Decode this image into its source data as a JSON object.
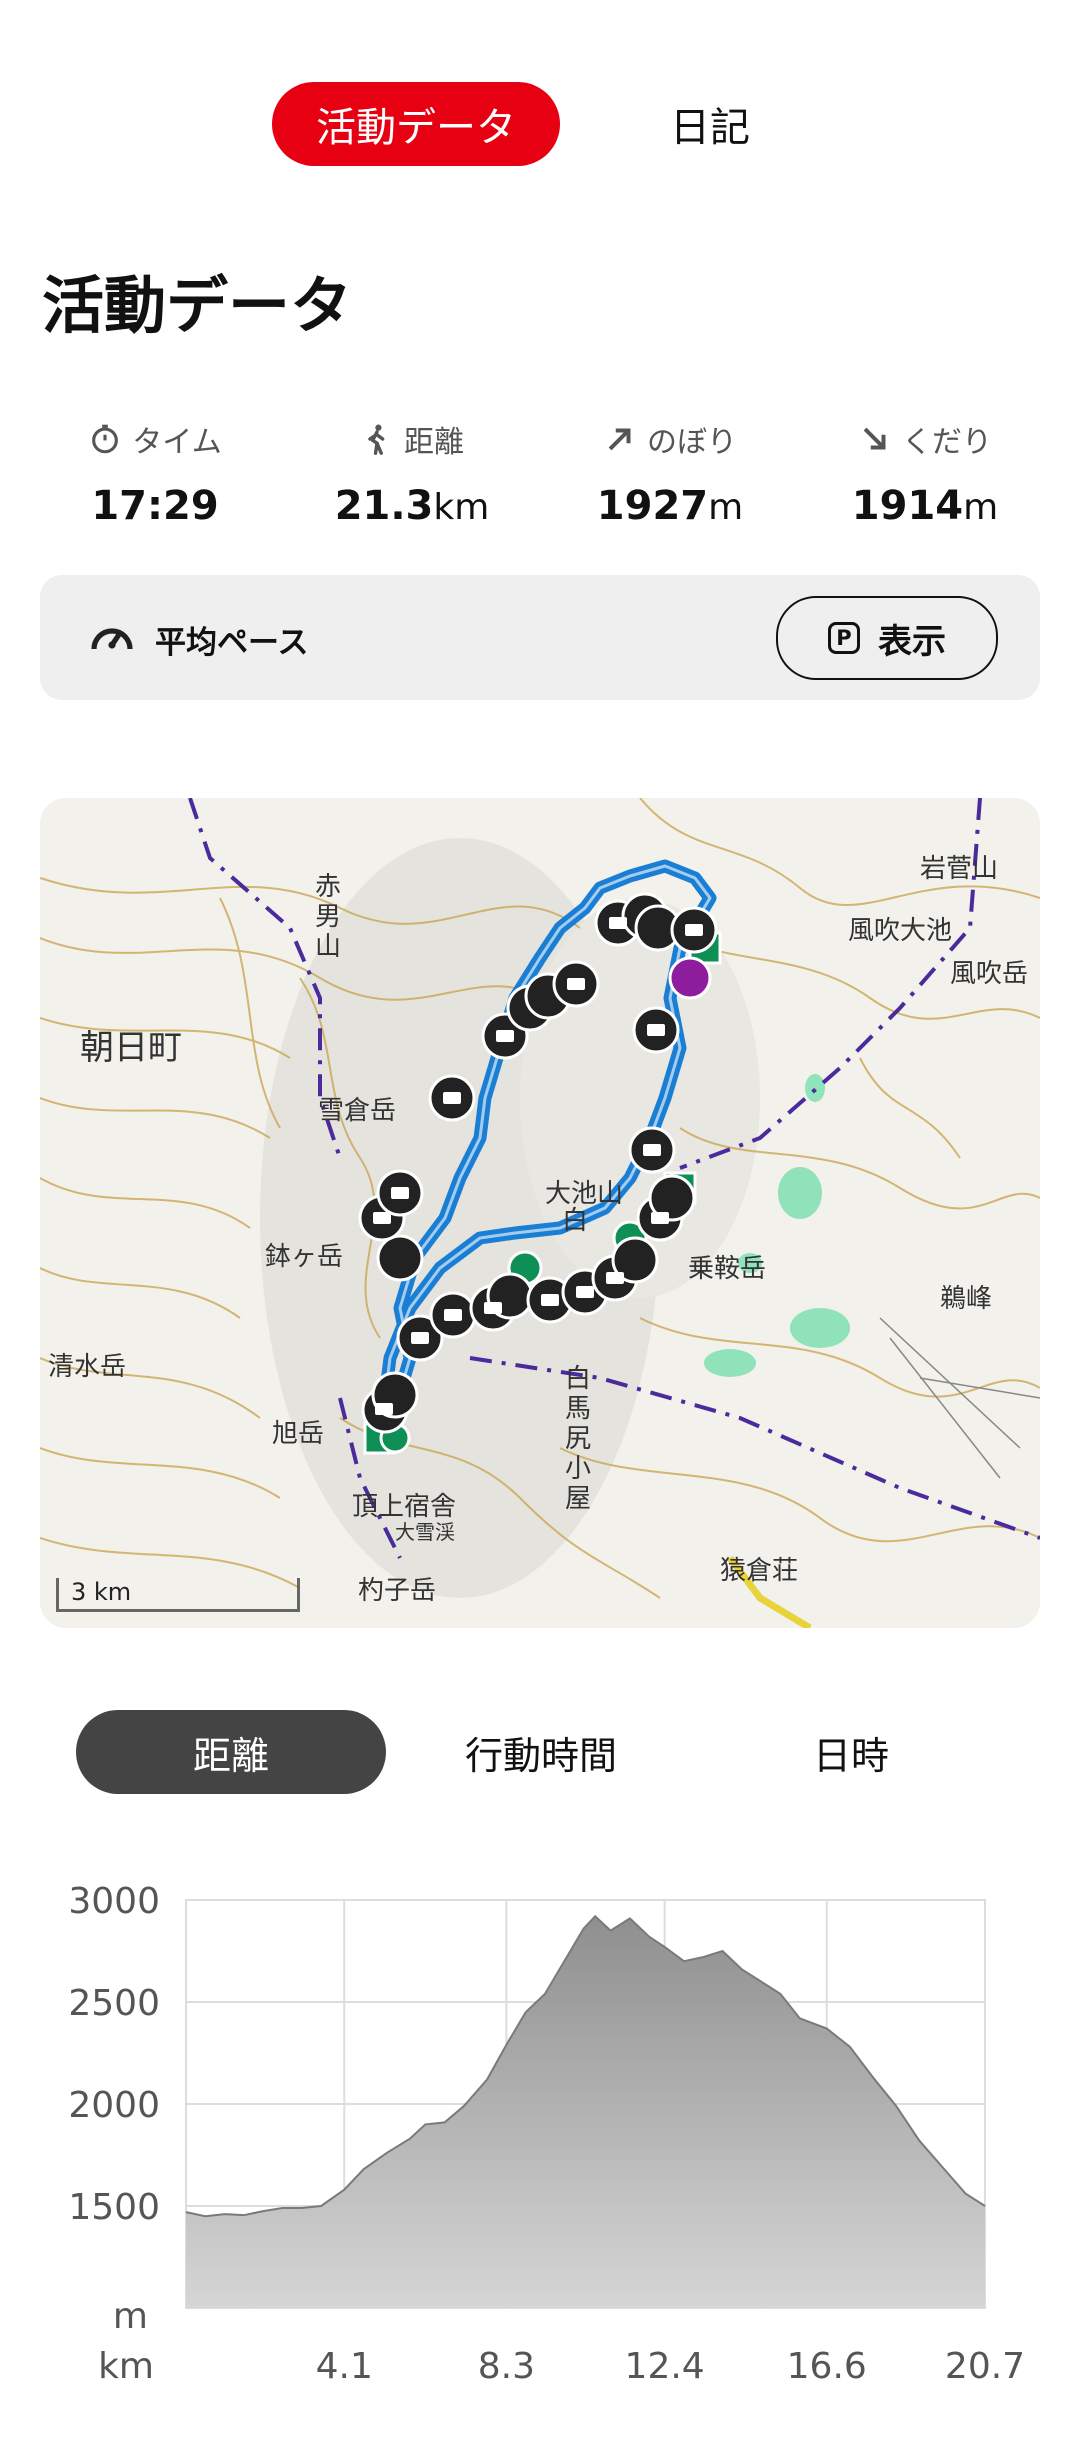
{
  "tabs": [
    {
      "label": "活動データ",
      "active": true
    },
    {
      "label": "日記",
      "active": false
    }
  ],
  "page_title": "活動データ",
  "stats": {
    "time": {
      "label": "タイム",
      "value": "17:29",
      "unit": ""
    },
    "distance": {
      "label": "距離",
      "value": "21.3",
      "unit": "km"
    },
    "ascent": {
      "label": "のぼり",
      "value": "1927",
      "unit": "m"
    },
    "descent": {
      "label": "くだり",
      "value": "1914",
      "unit": "m"
    }
  },
  "pace": {
    "label": "平均ペース",
    "button_label": "表示",
    "badge": "P"
  },
  "map": {
    "scale_label": "3 km",
    "labels": {
      "asahi_town": "朝日町",
      "akaoyama_a": "赤",
      "akaoyama_b": "男",
      "akaoyama_c": "山",
      "yukikuradake": "雪倉岳",
      "kiyomizudake": "清水岳",
      "asahidake": "旭岳",
      "iwasugeyama": "岩菅山",
      "kazefuki_oike": "風吹大池",
      "kazefukidake": "風吹岳",
      "oike_a": "大池山",
      "oike_b": "白",
      "norikuradake": "乗鞍岳",
      "hakubajiri_a": "白",
      "hakubajiri_b": "馬",
      "hakubajiri_c": "尻",
      "hakubajiri_d": "小",
      "hakubajiri_e": "屋",
      "chojo_shukusha": "頂上宿舎",
      "shakushidake": "杓子岳",
      "yarigatake": "大雪渓",
      "tsuruo": "鵜峰",
      "saruo_so": "猿倉荘",
      "hachi": "鉢ヶ岳"
    },
    "colors": {
      "route": "#1a7fd4",
      "contour": "#c9a24a",
      "boundary": "#4b2a9b",
      "pond": "#7fe0b3"
    }
  },
  "segments": [
    {
      "label": "距離",
      "active": true
    },
    {
      "label": "行動時間",
      "active": false
    },
    {
      "label": "日時",
      "active": false
    }
  ],
  "chart_data": {
    "type": "area",
    "ylabel": "m",
    "xlabel": "km",
    "ylim": [
      1000,
      3000
    ],
    "xlim": [
      0,
      20.7
    ],
    "y_ticks": [
      "3000",
      "2500",
      "2000",
      "1500"
    ],
    "x_ticks": [
      "4.1",
      "8.3",
      "12.4",
      "16.6",
      "20.7"
    ],
    "x": [
      0,
      0.5,
      1.0,
      1.5,
      2.0,
      2.5,
      3.0,
      3.5,
      4.1,
      4.6,
      5.2,
      5.8,
      6.2,
      6.7,
      7.2,
      7.8,
      8.3,
      8.8,
      9.3,
      9.8,
      10.3,
      10.6,
      11.0,
      11.5,
      12.0,
      12.4,
      12.9,
      13.4,
      13.9,
      14.4,
      14.9,
      15.4,
      15.9,
      16.6,
      17.2,
      17.8,
      18.4,
      19.0,
      19.6,
      20.2,
      20.7
    ],
    "y": [
      1470,
      1450,
      1460,
      1455,
      1475,
      1490,
      1490,
      1500,
      1580,
      1680,
      1760,
      1830,
      1900,
      1910,
      1990,
      2120,
      2290,
      2450,
      2540,
      2700,
      2860,
      2920,
      2850,
      2910,
      2820,
      2770,
      2700,
      2720,
      2750,
      2660,
      2600,
      2540,
      2420,
      2370,
      2280,
      2130,
      1990,
      1820,
      1690,
      1560,
      1500
    ]
  }
}
